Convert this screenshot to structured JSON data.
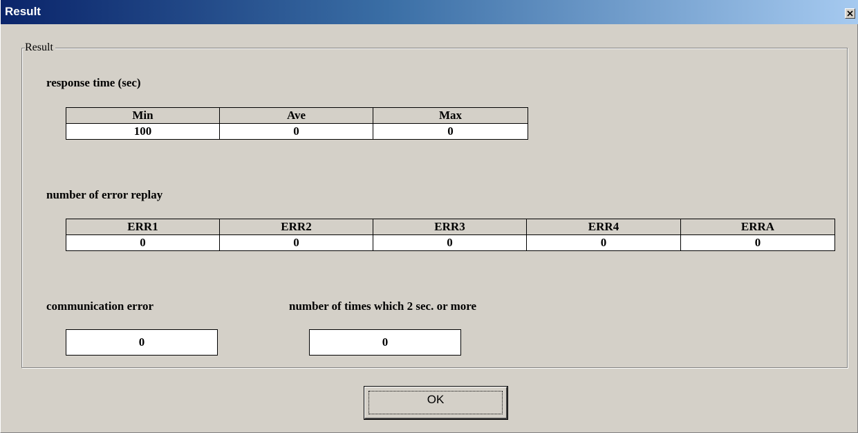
{
  "window": {
    "title": "Result",
    "close_symbol": "×"
  },
  "group": {
    "legend": "Result"
  },
  "response_time": {
    "label": "response time (sec)",
    "headers": [
      "Min",
      "Ave",
      "Max"
    ],
    "values": [
      "100",
      "0",
      "0"
    ]
  },
  "error_replay": {
    "label": "number of error replay",
    "headers": [
      "ERR1",
      "ERR2",
      "ERR3",
      "ERR4",
      "ERRA"
    ],
    "values": [
      "0",
      "0",
      "0",
      "0",
      "0"
    ]
  },
  "communication_error": {
    "label": "communication error",
    "value": "0"
  },
  "slow_responses": {
    "label": "number of times which 2 sec. or more",
    "value": "0"
  },
  "buttons": {
    "ok_label": "OK"
  },
  "colors": {
    "face": "#d4d0c8",
    "title_start": "#0a246a",
    "title_end": "#a6caf0"
  }
}
